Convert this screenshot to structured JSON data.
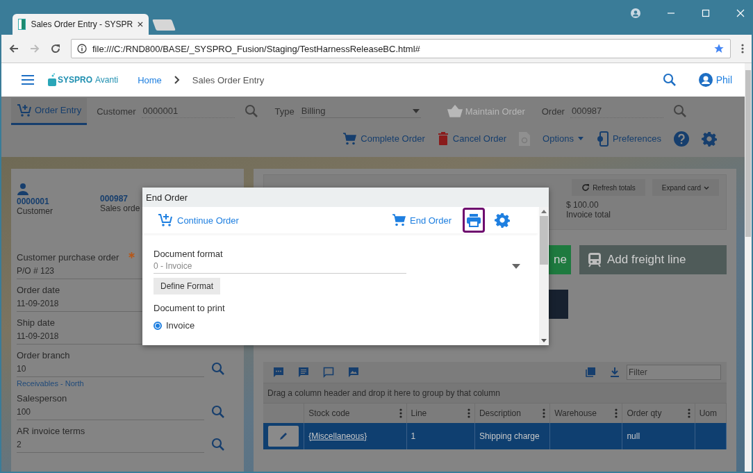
{
  "browser": {
    "tab_title": "Sales Order Entry - SYSPR",
    "url": "file:///C:/RND800/BASE/_SYSPRO_Fusion/Staging/TestHarnessReleaseBC.html#"
  },
  "header": {
    "brand": "SYSPRO",
    "brand_suffix": "Avanti",
    "breadcrumb": [
      "Home",
      "Sales Order Entry"
    ],
    "user": "Phil"
  },
  "toolbar": {
    "tab": {
      "label": "Order Entry",
      "selected": true
    },
    "customer_label": "Customer",
    "customer_value": "0000001",
    "type_label": "Type",
    "type_value": "Billing",
    "maintain_order": {
      "label": "Maintain Order",
      "disabled": true
    },
    "order_label": "Order",
    "order_value": "000987"
  },
  "actions": [
    {
      "kind": "complete",
      "label": "Complete Order"
    },
    {
      "kind": "cancel",
      "label": "Cancel Order"
    },
    {
      "kind": "history"
    },
    {
      "kind": "options",
      "label": "Options"
    },
    {
      "kind": "preferences",
      "label": "Preferences"
    },
    {
      "kind": "help"
    },
    {
      "kind": "settings"
    }
  ],
  "order_card": {
    "customer_code": "0000001",
    "customer_label": "Customer",
    "order_number": "000987",
    "order_label": "Sales orde",
    "fields": [
      {
        "label": "Customer purchase order",
        "value": "P/O # 123",
        "required": true,
        "lookup": false
      },
      {
        "label": "Order date",
        "value": "11-09-2018",
        "required": false,
        "lookup": false
      },
      {
        "label": "Ship date",
        "value": "11-09-2018",
        "required": false,
        "lookup": false
      },
      {
        "label": "Order branch",
        "value": "10",
        "required": false,
        "lookup": true,
        "note": "Receivables - North"
      },
      {
        "label": "Salesperson",
        "value": "100",
        "required": false,
        "lookup": true
      },
      {
        "label": "AR invoice terms",
        "value": "2",
        "required": false,
        "lookup": true
      }
    ]
  },
  "summary": {
    "refresh": "Refresh totals",
    "expand": "Expand card",
    "amount": "$ 100.00",
    "amount_label": "Invoice total"
  },
  "line_buttons": [
    {
      "kind": "add",
      "label": "ne"
    },
    {
      "kind": "freight",
      "label": "Add freight line"
    }
  ],
  "grid": {
    "filter_placeholder": "Filter",
    "group_hint": "Drag a column header and drop it here to group by that column",
    "columns": [
      "Stock code",
      "Line",
      "Description",
      "Warehouse",
      "Order qty",
      "Uom"
    ],
    "rows": [
      {
        "selected": true,
        "cells": [
          "{Miscellaneous}",
          "1",
          "Shipping charge",
          "",
          "null",
          ""
        ]
      }
    ]
  },
  "modal": {
    "title": "End Order",
    "continue": "Continue Order",
    "end": "End Order",
    "print_highlighted": true,
    "format_label": "Document format",
    "format_value": "0 - Invoice",
    "define": "Define Format",
    "print_label": "Document to print",
    "radios": [
      {
        "label": "Invoice",
        "selected": true
      }
    ]
  }
}
